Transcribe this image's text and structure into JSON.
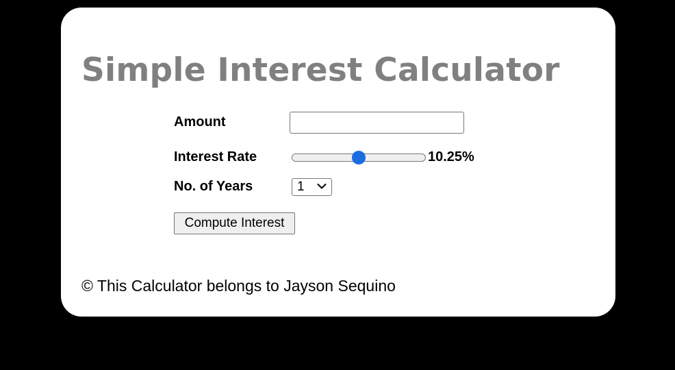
{
  "app": {
    "title": "Simple Interest Calculator"
  },
  "form": {
    "amount_label": "Amount",
    "amount_value": "",
    "rate_label": "Interest Rate",
    "rate_value_text": "10.25%",
    "rate_fraction": 0.5,
    "years_label": "No. of Years",
    "years_selected": "1",
    "compute_label": "Compute Interest"
  },
  "footer": {
    "text": "© This Calculator belongs to Jayson Sequino"
  },
  "colors": {
    "background": "#000000",
    "card": "#ffffff",
    "title": "#808080",
    "accent": "#1a6ce0"
  },
  "icons": {
    "select_chevron": "chevron-down-icon"
  }
}
